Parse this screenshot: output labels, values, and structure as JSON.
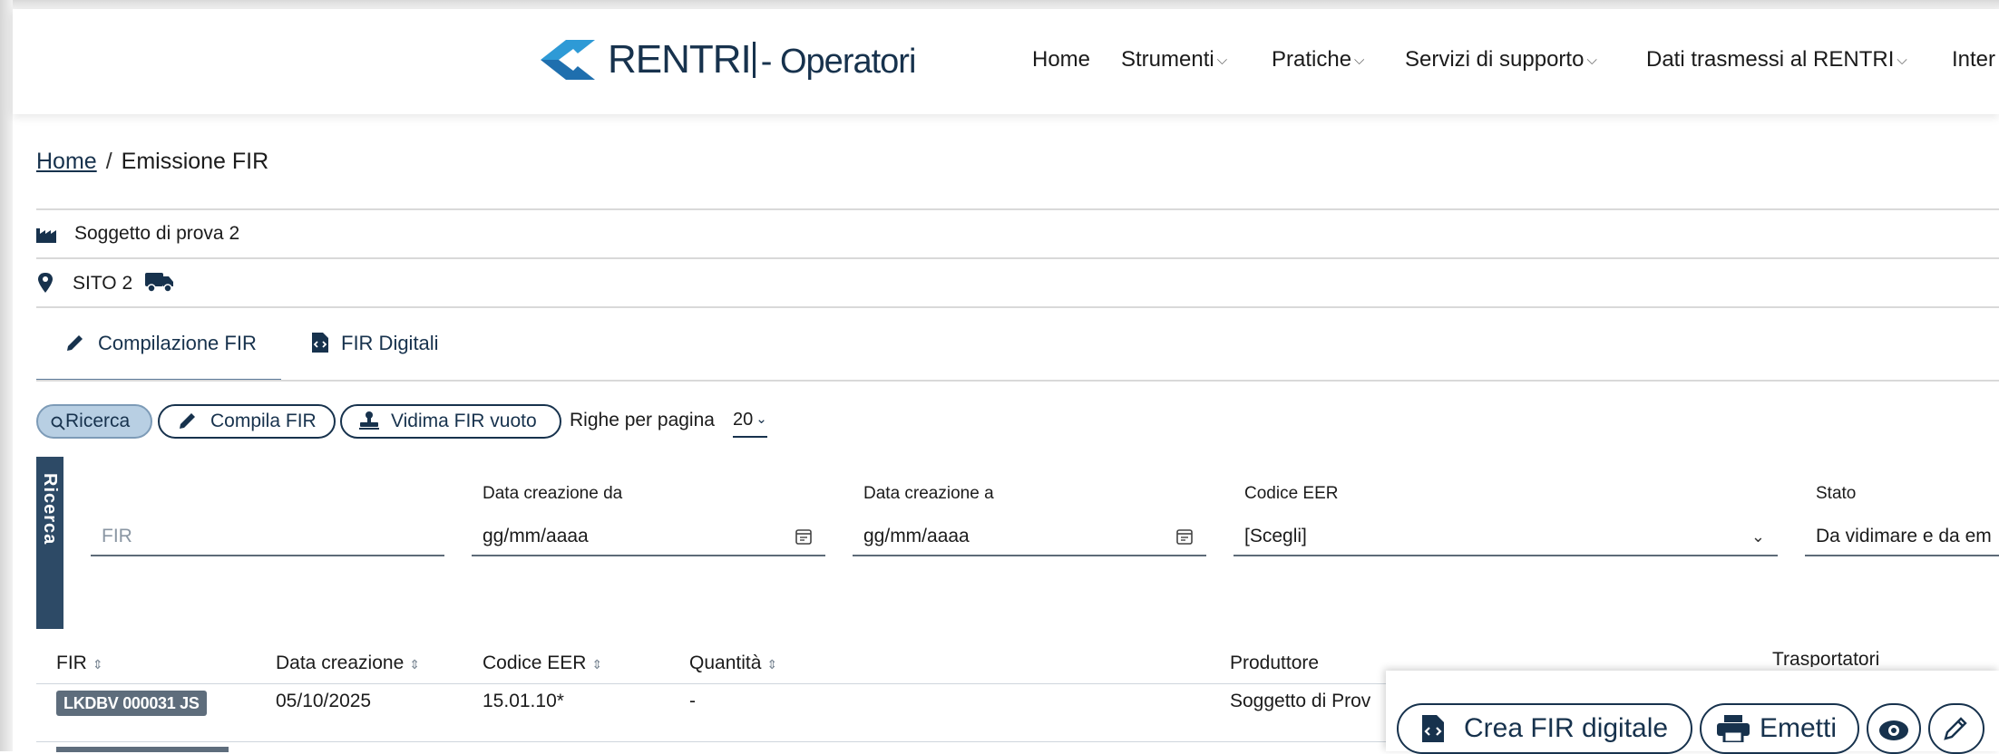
{
  "header": {
    "brand": "RENTRI",
    "brand_suffix": "- Operatori",
    "nav": [
      {
        "label": "Home",
        "dropdown": false
      },
      {
        "label": "Strumenti",
        "dropdown": true
      },
      {
        "label": "Pratiche",
        "dropdown": true
      },
      {
        "label": "Servizi di supporto",
        "dropdown": true
      },
      {
        "label": "Dati trasmessi al RENTRI",
        "dropdown": true
      },
      {
        "label": "Inter",
        "dropdown": false
      }
    ]
  },
  "breadcrumb": {
    "home": "Home",
    "separator": "/",
    "current": "Emissione FIR"
  },
  "context": {
    "subject": "Soggetto di prova 2",
    "site": "SITO 2",
    "subject_icon": "factory-icon",
    "site_icon": "map-pin-icon",
    "site_badge_icon": "truck-icon"
  },
  "tabs": [
    {
      "label": "Compilazione FIR",
      "icon": "pencil-icon",
      "active": true
    },
    {
      "label": "FIR Digitali",
      "icon": "file-code-icon",
      "active": false
    }
  ],
  "toolbar": {
    "search_label": "Ricerca",
    "compile_label": "Compila FIR",
    "stamp_label": "Vidima FIR vuoto",
    "rows_label": "Righe per pagina",
    "rows_value": "20"
  },
  "search": {
    "tab_label": "Ricerca",
    "fir_placeholder": "FIR",
    "date_from_label": "Data creazione da",
    "date_from_placeholder": "gg/mm/aaaa",
    "date_to_label": "Data creazione a",
    "date_to_placeholder": "gg/mm/aaaa",
    "eer_label": "Codice EER",
    "eer_value": "[Scegli]",
    "status_label": "Stato",
    "status_value": "Da vidimare e da em"
  },
  "table": {
    "columns": [
      "FIR",
      "Data creazione",
      "Codice EER",
      "Quantità",
      "Produttore",
      "Trasportatori"
    ],
    "rows": [
      {
        "fir": "LKDBV 000031 JS",
        "date": "05/10/2025",
        "eer": "15.01.10*",
        "quantity": "-",
        "producer": "Soggetto di Prov"
      }
    ]
  },
  "row_actions": {
    "create_digital": "Crea FIR digitale",
    "emit": "Emetti",
    "view_icon": "eye-icon",
    "edit_icon": "pencil-icon"
  },
  "colors": {
    "primary": "#17324d",
    "accent_blue": "#2e9ad6",
    "badge": "#5e6d7c",
    "search_tab": "#2d4a66"
  }
}
